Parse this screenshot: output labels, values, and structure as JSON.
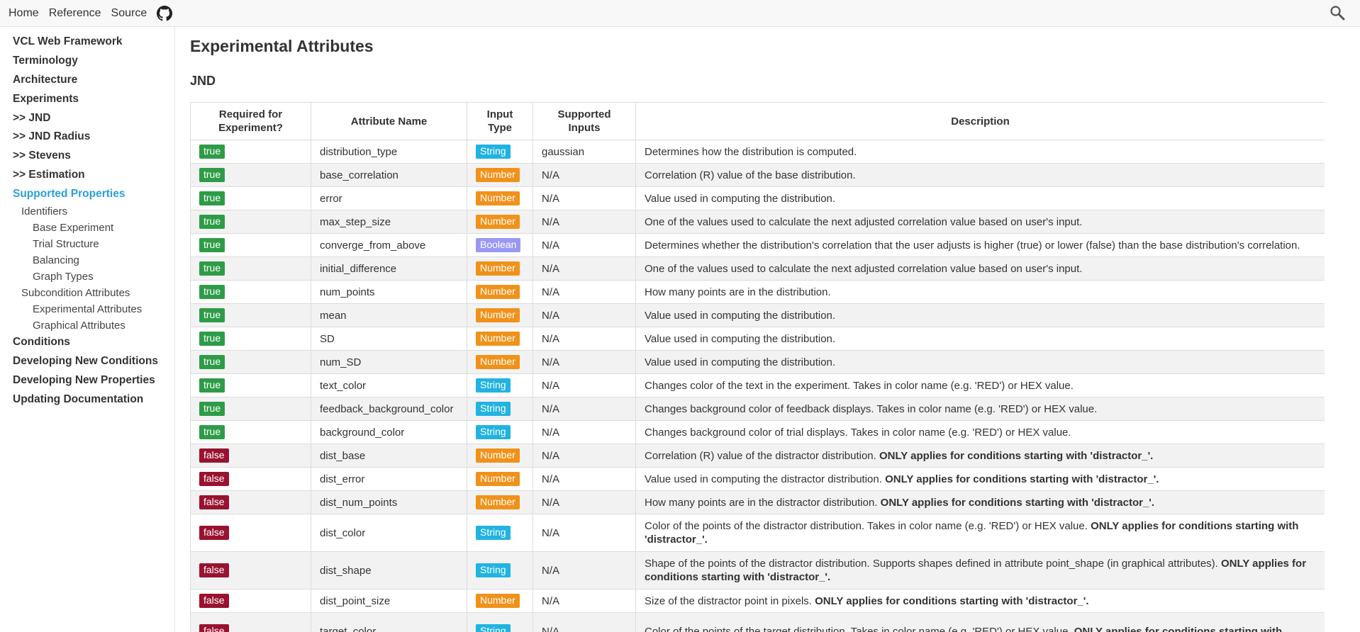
{
  "topbar": {
    "nav": [
      "Home",
      "Reference",
      "Source"
    ],
    "github_icon": "github-icon",
    "search_icon": "search-icon"
  },
  "sidebar": {
    "items": [
      {
        "label": "VCL Web Framework",
        "level": 1
      },
      {
        "label": "Terminology",
        "level": 1
      },
      {
        "label": "Architecture",
        "level": 1
      },
      {
        "label": "Experiments",
        "level": 1
      },
      {
        "label": ">> JND",
        "level": 1
      },
      {
        "label": ">> JND Radius",
        "level": 1
      },
      {
        "label": ">> Stevens",
        "level": 1
      },
      {
        "label": ">> Estimation",
        "level": 1
      },
      {
        "label": "Supported Properties",
        "level": 1,
        "active": true
      },
      {
        "label": "Identifiers",
        "level": 2
      },
      {
        "label": "Base Experiment",
        "level": 3
      },
      {
        "label": "Trial Structure",
        "level": 3
      },
      {
        "label": "Balancing",
        "level": 3
      },
      {
        "label": "Graph Types",
        "level": 3
      },
      {
        "label": "Subcondition Attributes",
        "level": 2
      },
      {
        "label": "Experimental Attributes",
        "level": 3
      },
      {
        "label": "Graphical Attributes",
        "level": 3
      },
      {
        "label": "Conditions",
        "level": 1
      },
      {
        "label": "Developing New Conditions",
        "level": 1
      },
      {
        "label": "Developing New Properties",
        "level": 1
      },
      {
        "label": "Updating Documentation",
        "level": 1
      }
    ]
  },
  "main": {
    "title": "Experimental Attributes",
    "section": "JND",
    "table": {
      "headers": [
        "Required for Experiment?",
        "Attribute Name",
        "Input Type",
        "Supported Inputs",
        "Description"
      ],
      "rows": [
        {
          "required": "true",
          "name": "distribution_type",
          "type": "String",
          "inputs": "gaussian",
          "desc": "Determines how the distribution is computed.",
          "note": ""
        },
        {
          "required": "true",
          "name": "base_correlation",
          "type": "Number",
          "inputs": "N/A",
          "desc": "Correlation (R) value of the base distribution.",
          "note": ""
        },
        {
          "required": "true",
          "name": "error",
          "type": "Number",
          "inputs": "N/A",
          "desc": "Value used in computing the distribution.",
          "note": ""
        },
        {
          "required": "true",
          "name": "max_step_size",
          "type": "Number",
          "inputs": "N/A",
          "desc": "One of the values used to calculate the next adjusted correlation value based on user's input.",
          "note": ""
        },
        {
          "required": "true",
          "name": "converge_from_above",
          "type": "Boolean",
          "inputs": "N/A",
          "desc": "Determines whether the distribution's correlation that the user adjusts is higher (true) or lower (false) than the base distribution's correlation.",
          "note": ""
        },
        {
          "required": "true",
          "name": "initial_difference",
          "type": "Number",
          "inputs": "N/A",
          "desc": "One of the values used to calculate the next adjusted correlation value based on user's input.",
          "note": ""
        },
        {
          "required": "true",
          "name": "num_points",
          "type": "Number",
          "inputs": "N/A",
          "desc": "How many points are in the distribution.",
          "note": ""
        },
        {
          "required": "true",
          "name": "mean",
          "type": "Number",
          "inputs": "N/A",
          "desc": "Value used in computing the distribution.",
          "note": ""
        },
        {
          "required": "true",
          "name": "SD",
          "type": "Number",
          "inputs": "N/A",
          "desc": "Value used in computing the distribution.",
          "note": ""
        },
        {
          "required": "true",
          "name": "num_SD",
          "type": "Number",
          "inputs": "N/A",
          "desc": "Value used in computing the distribution.",
          "note": ""
        },
        {
          "required": "true",
          "name": "text_color",
          "type": "String",
          "inputs": "N/A",
          "desc": "Changes color of the text in the experiment. Takes in color name (e.g. 'RED') or HEX value.",
          "note": ""
        },
        {
          "required": "true",
          "name": "feedback_background_color",
          "type": "String",
          "inputs": "N/A",
          "desc": "Changes background color of feedback displays. Takes in color name (e.g. 'RED') or HEX value.",
          "note": ""
        },
        {
          "required": "true",
          "name": "background_color",
          "type": "String",
          "inputs": "N/A",
          "desc": "Changes background color of trial displays. Takes in color name (e.g. 'RED') or HEX value.",
          "note": ""
        },
        {
          "required": "false",
          "name": "dist_base",
          "type": "Number",
          "inputs": "N/A",
          "desc": "Correlation (R) value of the distractor distribution. ",
          "note": "ONLY applies for conditions starting with 'distractor_'."
        },
        {
          "required": "false",
          "name": "dist_error",
          "type": "Number",
          "inputs": "N/A",
          "desc": "Value used in computing the distractor distribution. ",
          "note": "ONLY applies for conditions starting with 'distractor_'."
        },
        {
          "required": "false",
          "name": "dist_num_points",
          "type": "Number",
          "inputs": "N/A",
          "desc": "How many points are in the distractor distribution. ",
          "note": "ONLY applies for conditions starting with 'distractor_'."
        },
        {
          "required": "false",
          "name": "dist_color",
          "type": "String",
          "inputs": "N/A",
          "desc": "Color of the points of the distractor distribution. Takes in color name (e.g. 'RED') or HEX value. ",
          "note": "ONLY applies for conditions starting with 'distractor_'.",
          "tall": true
        },
        {
          "required": "false",
          "name": "dist_shape",
          "type": "String",
          "inputs": "N/A",
          "desc": "Shape of the points of the distractor distribution. Supports shapes defined in attribute point_shape (in graphical attributes). ",
          "note": "ONLY applies for conditions starting with 'distractor_'.",
          "tall": true
        },
        {
          "required": "false",
          "name": "dist_point_size",
          "type": "Number",
          "inputs": "N/A",
          "desc": "Size of the distractor point in pixels. ",
          "note": "ONLY applies for conditions starting with 'distractor_'."
        },
        {
          "required": "false",
          "name": "target_color",
          "type": "String",
          "inputs": "N/A",
          "desc": "Color of the points of the target distribution. Takes in color name (e.g. 'RED') or HEX value. ",
          "note": "ONLY applies for conditions starting with",
          "tall": true
        }
      ]
    }
  },
  "colors": {
    "true_badge": "#2e9c47",
    "false_badge": "#99122f",
    "string_badge": "#21b3e2",
    "number_badge": "#f0921a",
    "boolean_badge": "#9b98f2",
    "active_link": "#2a9fd6"
  }
}
